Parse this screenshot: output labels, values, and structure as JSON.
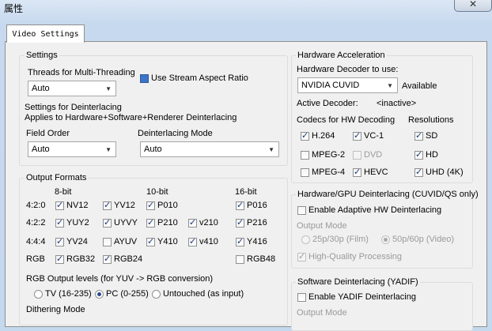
{
  "window": {
    "title": "属性",
    "close": "✕"
  },
  "tabs": [
    {
      "label": "Video Settings"
    }
  ],
  "settings": {
    "title": "Settings",
    "threads_label": "Threads for Multi-Threading",
    "threads_value": "Auto",
    "use_stream_aspect": "Use Stream Aspect Ratio",
    "deinterlace_title": "Settings for Deinterlacing",
    "deinterlace_note": "Applies to Hardware+Software+Renderer Deinterlacing",
    "field_order_label": "Field Order",
    "field_order_value": "Auto",
    "deint_mode_label": "Deinterlacing Mode",
    "deint_mode_value": "Auto"
  },
  "output_formats": {
    "title": "Output Formats",
    "col_headers": [
      "8-bit",
      "10-bit",
      "16-bit"
    ],
    "row_labels": [
      "4:2:0",
      "4:2:2",
      "4:4:4",
      "RGB"
    ],
    "items": {
      "nv12": "NV12",
      "yv12": "YV12",
      "p010": "P010",
      "p016": "P016",
      "yuy2": "YUY2",
      "uyvy": "UYVY",
      "p210": "P210",
      "v210": "v210",
      "p216": "P216",
      "yv24": "YV24",
      "ayuv": "AYUV",
      "y410": "Y410",
      "v410": "v410",
      "y416": "Y416",
      "rgb32": "RGB32",
      "rgb24": "RGB24",
      "rgb48": "RGB48"
    },
    "rgb_levels_label": "RGB Output levels (for YUV -> RGB conversion)",
    "rgb_levels": [
      "TV (16-235)",
      "PC (0-255)",
      "Untouched (as input)"
    ],
    "dithering_label": "Dithering Mode"
  },
  "hw_accel": {
    "title": "Hardware Acceleration",
    "decoder_label": "Hardware Decoder to use:",
    "decoder_value": "NVIDIA CUVID",
    "available": "Available",
    "active_label": "Active Decoder:",
    "active_value": "<inactive>",
    "codecs_label": "Codecs for HW Decoding",
    "resolutions_label": "Resolutions",
    "codecs": {
      "h264": "H.264",
      "vc1": "VC-1",
      "mpeg2": "MPEG-2",
      "dvd": "DVD",
      "mpeg4": "MPEG-4",
      "hevc": "HEVC"
    },
    "resolutions": {
      "sd": "SD",
      "hd": "HD",
      "uhd": "UHD (4K)"
    }
  },
  "hw_deint": {
    "title": "Hardware/GPU Deinterlacing (CUVID/QS only)",
    "adaptive": "Enable Adaptive HW Deinterlacing",
    "output_mode": "Output Mode",
    "film": "25p/30p (Film)",
    "video": "50p/60p (Video)",
    "hq": "High-Quality Processing"
  },
  "sw_deint": {
    "title": "Software Deinterlacing (YADIF)",
    "yadif": "Enable YADIF Deinterlacing",
    "output_mode": "Output Mode"
  }
}
